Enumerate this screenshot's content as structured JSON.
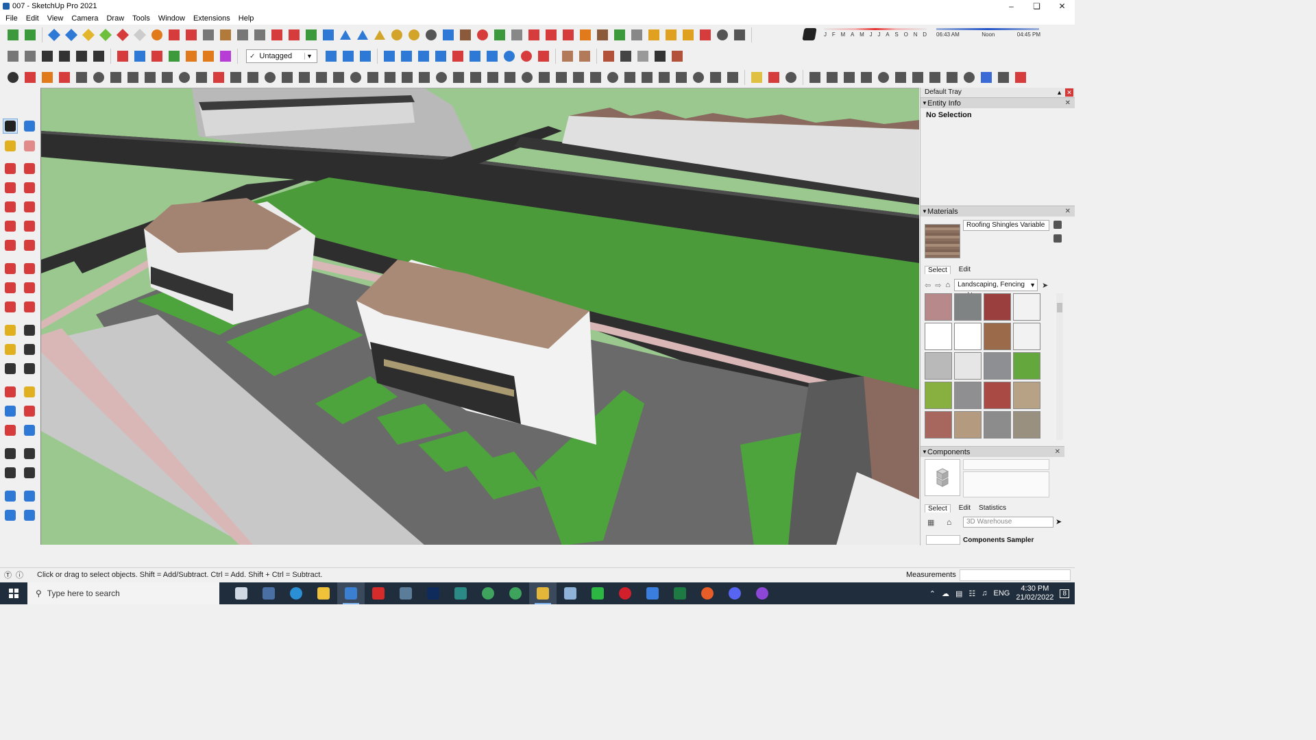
{
  "window": {
    "title": "007 - SketchUp Pro 2021",
    "controls": [
      "minimize",
      "restore",
      "close"
    ]
  },
  "menu": [
    "File",
    "Edit",
    "View",
    "Camera",
    "Draw",
    "Tools",
    "Window",
    "Extensions",
    "Help"
  ],
  "toolbar": {
    "tag_selected": "Untagged"
  },
  "shadow": {
    "months": [
      "J",
      "F",
      "M",
      "A",
      "M",
      "J",
      "J",
      "A",
      "S",
      "O",
      "N",
      "D"
    ],
    "time_start": "06:43 AM",
    "time_mid": "Noon",
    "time_end": "04:45 PM"
  },
  "tray": {
    "title": "Default Tray",
    "entity_info": {
      "header": "Entity Info",
      "value": "No Selection"
    },
    "materials": {
      "header": "Materials",
      "current_material": "Roofing Shingles Variable",
      "tabs": [
        "Select",
        "Edit"
      ],
      "library": "Landscaping, Fencing and '",
      "swatch_colors": [
        "#b7898a",
        "#7f8384",
        "#9b3e3e",
        "#f2f2f2",
        "#ffffff",
        "#ffffff",
        "#9a6a4a",
        "#f2f2f2",
        "#b9b9b9",
        "#e6e6e6",
        "#8d8f92",
        "#64a83d",
        "#88b041",
        "#8f8f92",
        "#a94a44",
        "#b8a285",
        "#a8675e",
        "#b49a7e",
        "#8c8c8c",
        "#9a9080"
      ]
    },
    "components": {
      "header": "Components",
      "tabs": [
        "Select",
        "Edit",
        "Statistics"
      ],
      "search_placeholder": "3D Warehouse",
      "sampler": "Components Sampler"
    }
  },
  "statusbar": {
    "hint": "Click or drag to select objects. Shift = Add/Subtract. Ctrl = Add. Shift + Ctrl = Subtract.",
    "measurements_label": "Measurements"
  },
  "taskbar": {
    "search_placeholder": "Type here to search",
    "apps": [
      {
        "name": "task-view",
        "color": "#cfd8e3"
      },
      {
        "name": "calculator",
        "color": "#4a6fa5"
      },
      {
        "name": "edge",
        "color": "#2b8fd6"
      },
      {
        "name": "file-explorer",
        "color": "#f0c23a"
      },
      {
        "name": "sketchup",
        "color": "#3b7fd0"
      },
      {
        "name": "acrobat",
        "color": "#d62b2b"
      },
      {
        "name": "app-sharp",
        "color": "#5b7d99"
      },
      {
        "name": "photoshop",
        "color": "#0f2b5c"
      },
      {
        "name": "app-green",
        "color": "#2c8a86"
      },
      {
        "name": "chrome",
        "color": "#3da35d"
      },
      {
        "name": "chrome-profile",
        "color": "#3da35d"
      },
      {
        "name": "sketchup-layout",
        "color": "#e3b538"
      },
      {
        "name": "notes",
        "color": "#8fb3d8"
      },
      {
        "name": "whatsapp",
        "color": "#2bb741"
      },
      {
        "name": "opera",
        "color": "#d21f2c"
      },
      {
        "name": "todo",
        "color": "#3a7ee0"
      },
      {
        "name": "excel",
        "color": "#1e7a43"
      },
      {
        "name": "grammarly",
        "color": "#e85d27"
      },
      {
        "name": "discord",
        "color": "#5865f2"
      },
      {
        "name": "app-purple",
        "color": "#8d47d6"
      }
    ],
    "language": "ENG",
    "time": "4:30 PM",
    "date": "21/02/2022",
    "notifications": "8"
  }
}
